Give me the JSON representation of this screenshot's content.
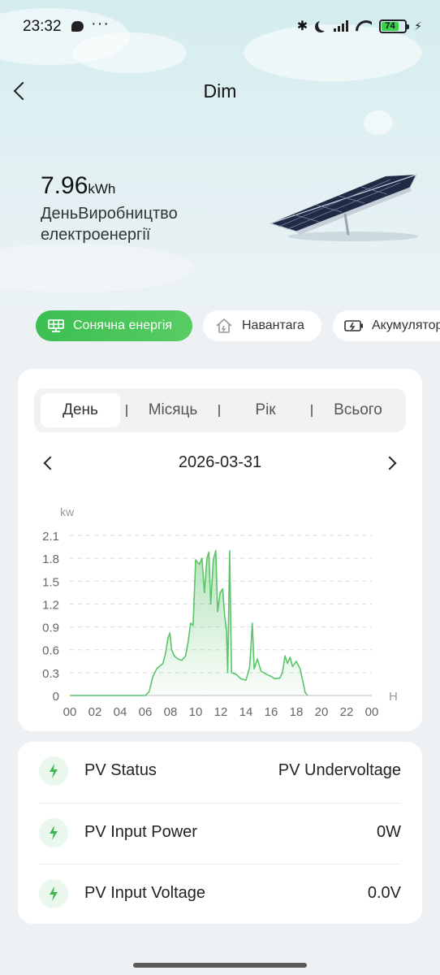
{
  "status_bar": {
    "time": "23:32",
    "more": "···",
    "battery_level": "74",
    "battery_color": "#3ccf4e"
  },
  "header": {
    "title": "Dim"
  },
  "summary": {
    "energy_value": "7.96",
    "energy_unit": "kWh",
    "label": "ДеньВиробництво електроенергії"
  },
  "category_tabs": [
    {
      "label": "Сонячна енергія",
      "icon": "solar-panel-icon",
      "active": true
    },
    {
      "label": "Навантага",
      "icon": "house-icon",
      "active": false
    },
    {
      "label": "Акумулятор",
      "icon": "battery-icon",
      "active": false
    }
  ],
  "period_tabs": [
    {
      "label": "День",
      "active": true
    },
    {
      "label": "Місяць",
      "active": false
    },
    {
      "label": "Рік",
      "active": false
    },
    {
      "label": "Всього",
      "active": false
    }
  ],
  "date": "2026-03-31",
  "chart_data": {
    "type": "area",
    "ylabel": "kw",
    "xlabel": "H",
    "ylim": [
      0,
      2.1
    ],
    "y_ticks": [
      "2.1",
      "1.8",
      "1.5",
      "1.2",
      "0.9",
      "0.6",
      "0.3",
      "0"
    ],
    "x_ticks": [
      "00",
      "02",
      "04",
      "06",
      "08",
      "10",
      "12",
      "14",
      "16",
      "18",
      "20",
      "22",
      "00"
    ],
    "grid": "horizontal-dashed",
    "accent_color": "#5cc46a",
    "series": [
      {
        "points": [
          [
            0,
            0
          ],
          [
            6.0,
            0
          ],
          [
            6.3,
            0.05
          ],
          [
            6.6,
            0.25
          ],
          [
            6.9,
            0.35
          ],
          [
            7.1,
            0.38
          ],
          [
            7.4,
            0.42
          ],
          [
            7.6,
            0.55
          ],
          [
            7.8,
            0.75
          ],
          [
            7.95,
            0.82
          ],
          [
            8.1,
            0.6
          ],
          [
            8.3,
            0.52
          ],
          [
            8.6,
            0.48
          ],
          [
            8.9,
            0.46
          ],
          [
            9.2,
            0.52
          ],
          [
            9.4,
            0.7
          ],
          [
            9.6,
            0.95
          ],
          [
            9.8,
            0.92
          ],
          [
            10.0,
            1.78
          ],
          [
            10.3,
            1.72
          ],
          [
            10.5,
            1.8
          ],
          [
            10.7,
            1.35
          ],
          [
            10.9,
            1.8
          ],
          [
            11.05,
            1.88
          ],
          [
            11.2,
            1.2
          ],
          [
            11.4,
            1.78
          ],
          [
            11.6,
            1.9
          ],
          [
            11.75,
            1.1
          ],
          [
            11.95,
            1.35
          ],
          [
            12.15,
            1.4
          ],
          [
            12.3,
            1.05
          ],
          [
            12.45,
            0.85
          ],
          [
            12.55,
            0.3
          ],
          [
            12.7,
            1.9
          ],
          [
            12.85,
            0.3
          ],
          [
            13.2,
            0.28
          ],
          [
            13.6,
            0.22
          ],
          [
            14.0,
            0.2
          ],
          [
            14.3,
            0.38
          ],
          [
            14.5,
            0.95
          ],
          [
            14.65,
            0.35
          ],
          [
            14.9,
            0.48
          ],
          [
            15.2,
            0.32
          ],
          [
            15.6,
            0.28
          ],
          [
            16.0,
            0.25
          ],
          [
            16.3,
            0.22
          ],
          [
            16.7,
            0.23
          ],
          [
            16.9,
            0.3
          ],
          [
            17.1,
            0.52
          ],
          [
            17.3,
            0.42
          ],
          [
            17.5,
            0.5
          ],
          [
            17.7,
            0.38
          ],
          [
            18.0,
            0.45
          ],
          [
            18.3,
            0.35
          ],
          [
            18.5,
            0.2
          ],
          [
            18.7,
            0.04
          ],
          [
            18.9,
            0
          ]
        ]
      }
    ]
  },
  "info_rows": [
    {
      "label": "PV Status",
      "value": "PV Undervoltage"
    },
    {
      "label": "PV Input Power",
      "value": "0W"
    },
    {
      "label": "PV Input Voltage",
      "value": "0.0V"
    }
  ]
}
